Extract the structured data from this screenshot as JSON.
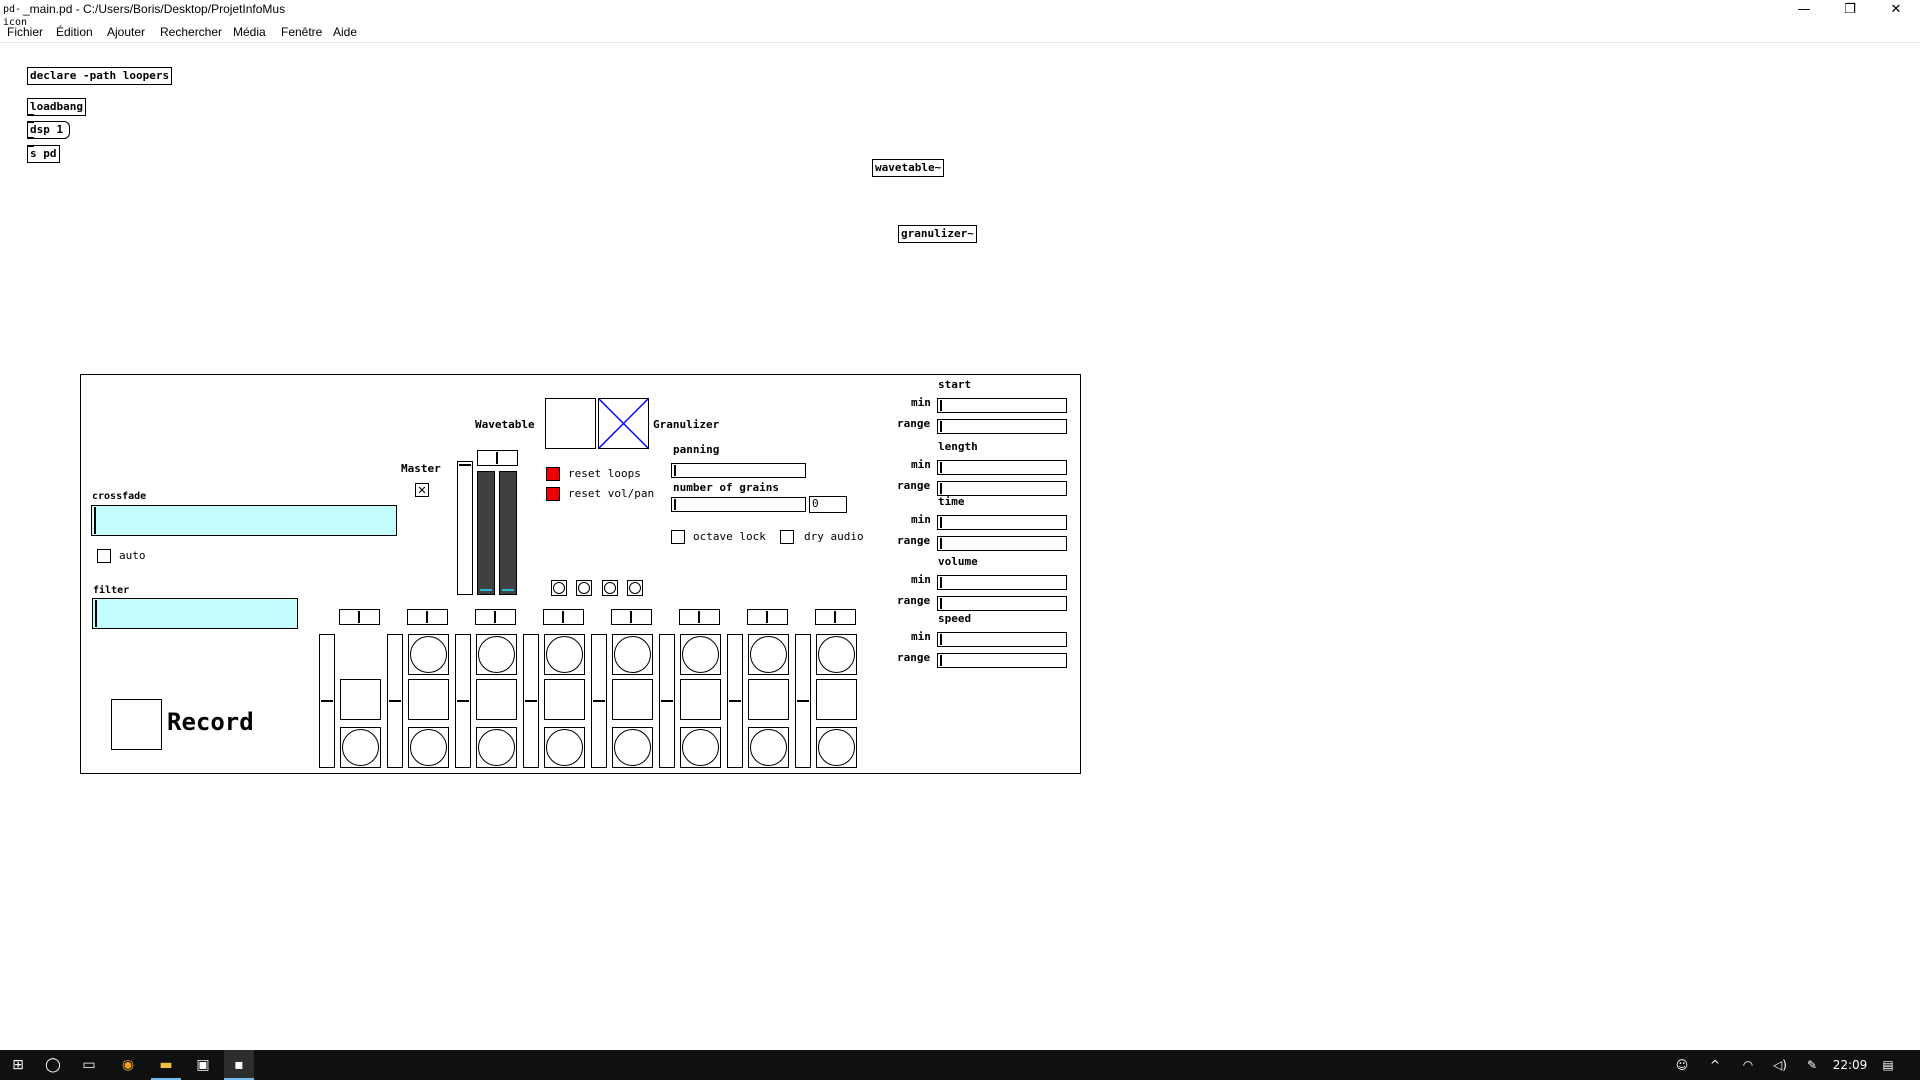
{
  "window": {
    "title": "_main.pd  - C:/Users/Boris/Desktop/ProjetInfoMus",
    "app_icon": "pd-icon",
    "minimize": "—",
    "restore": "❐",
    "close": "✕"
  },
  "menu": [
    "Fichier",
    "Édition",
    "Ajouter",
    "Rechercher",
    "Média",
    "Fenêtre",
    "Aide"
  ],
  "objects": {
    "declare": "declare -path loopers",
    "loadbang": "loadbang",
    "dsp": "dsp 1",
    "send_pd": "s pd",
    "wavetable": "wavetable~",
    "granulizer": "granulizer~"
  },
  "panel": {
    "crossfade_label": "crossfade",
    "auto_label": "auto",
    "filter_label": "filter",
    "record_label": "Record",
    "master_label": "Master",
    "wavetable_label": "Wavetable",
    "granulizer_label": "Granulizer",
    "reset_loops_label": "reset loops",
    "reset_volpan_label": "reset vol/pan",
    "panning_label": "panning",
    "grains_label": "number of grains",
    "grains_value": "0",
    "octave_lock_label": "octave lock",
    "dry_audio_label": "dry audio",
    "params": [
      {
        "name": "start",
        "min": "min",
        "range": "range"
      },
      {
        "name": "length",
        "min": "min",
        "range": "range"
      },
      {
        "name": "time",
        "min": "min",
        "range": "range"
      },
      {
        "name": "volume",
        "min": "min",
        "range": "range"
      },
      {
        "name": "speed",
        "min": "min",
        "range": "range"
      }
    ],
    "loop_count": 8
  },
  "taskbar": {
    "start": "⊞",
    "search": "◯",
    "taskview": "▭",
    "chrome": "◉",
    "explorer": "▬",
    "store": "▣",
    "pd": "▪",
    "people": "☺",
    "chevron": "^",
    "network": "◠",
    "volume": "◁)",
    "pen": "✎",
    "time": "22:09",
    "notifications": "▤"
  },
  "colors": {
    "cyan": "#c4fcfc",
    "reset_red": "#e00000",
    "granulizer_x": "#0000ff",
    "vu_meter": "#404040",
    "taskbar": "#101010"
  }
}
